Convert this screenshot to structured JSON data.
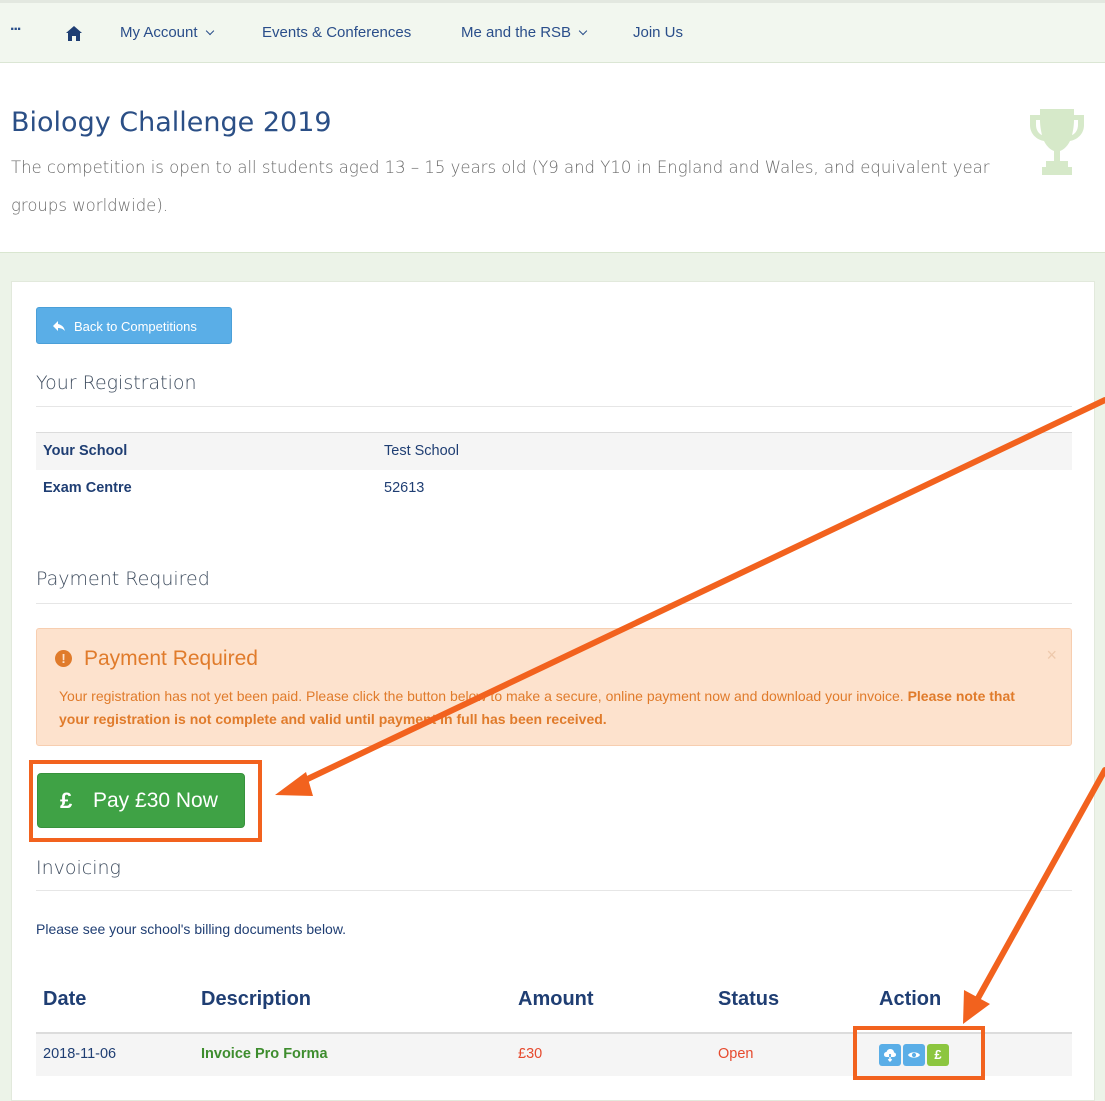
{
  "nav": {
    "more": "...",
    "my_account": "My Account",
    "events": "Events & Conferences",
    "me_and_rsb": "Me and the RSB",
    "join_us": "Join Us"
  },
  "hero": {
    "title": "Biology Challenge 2019",
    "subtitle": "The competition is open to all students aged 13 – 15 years old (Y9 and Y10 in England and Wales, and equivalent year groups worldwide)."
  },
  "back_button": "Back to Competitions",
  "registration": {
    "heading": "Your Registration",
    "rows": [
      {
        "label": "Your School",
        "value": "Test School"
      },
      {
        "label": "Exam Centre",
        "value": "52613"
      }
    ]
  },
  "payment": {
    "heading": "Payment Required",
    "alert_title": "Payment Required",
    "alert_text": "Your registration has not yet been paid. Please click the button below to make a secure, online payment now and download your invoice. ",
    "alert_bold": "Please note that your registration is not complete and valid until payment in full has been received.",
    "close": "×",
    "pay_symbol": "£",
    "pay_label": "Pay £30 Now"
  },
  "invoicing": {
    "heading": "Invoicing",
    "note": "Please see your school's billing documents below.",
    "columns": [
      "Date",
      "Description",
      "Amount",
      "Status",
      "Action"
    ],
    "rows": [
      {
        "date": "2018-11-06",
        "description": "Invoice Pro Forma",
        "amount": "£30",
        "status": "Open"
      }
    ],
    "actions": [
      "download-icon",
      "view-icon",
      "pay-icon"
    ],
    "pay_action_symbol": "£"
  },
  "colors": {
    "nav_link": "#2a4e8a",
    "pay_button": "#3fa245",
    "alert_bg": "#fde2cd",
    "alert_text": "#e07b2b",
    "callout": "#f2621e",
    "action_blue": "#5aaee7",
    "action_green": "#8cc63f"
  }
}
